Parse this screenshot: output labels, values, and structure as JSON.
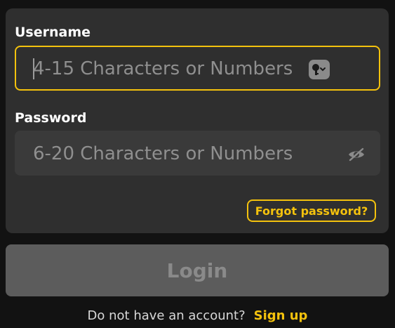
{
  "form": {
    "username": {
      "label": "Username",
      "placeholder": "4-15 Characters or Numbers",
      "icon": "key-icon"
    },
    "password": {
      "label": "Password",
      "placeholder": "6-20 Characters or Numbers",
      "icon": "eye-slash-icon"
    },
    "forgot_password_label": "Forgot password?",
    "login_label": "Login",
    "signup_prompt": "Do not have an account?",
    "signup_label": "Sign up"
  },
  "colors": {
    "background": "#121212",
    "card": "#2f2f2f",
    "input": "#3a3a3a",
    "accent": "#f4c20d",
    "button": "#5c5c5c",
    "placeholder": "#8f8f8f"
  }
}
